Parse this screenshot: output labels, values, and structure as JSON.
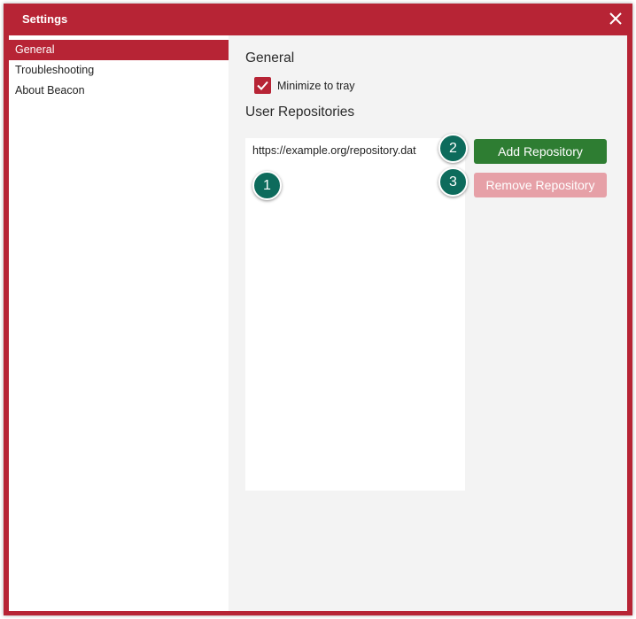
{
  "window": {
    "title": "Settings"
  },
  "sidebar": {
    "items": [
      {
        "label": "General",
        "active": true
      },
      {
        "label": "Troubleshooting",
        "active": false
      },
      {
        "label": "About Beacon",
        "active": false
      }
    ]
  },
  "general": {
    "heading": "General",
    "minimize_to_tray": {
      "label": "Minimize to tray",
      "checked": true
    },
    "repos_heading": "User Repositories",
    "repositories": [
      "https://example.org/repository.dat"
    ],
    "add_button": "Add Repository",
    "remove_button": "Remove Repository"
  },
  "callouts": [
    "1",
    "2",
    "3"
  ],
  "colors": {
    "accent": "#b72435",
    "add_button": "#2e7d32",
    "remove_button_disabled": "#e6a0a7",
    "callout": "#0d6b5c"
  },
  "icons": {
    "close": "close-icon",
    "checkbox": "checkmark-icon"
  }
}
